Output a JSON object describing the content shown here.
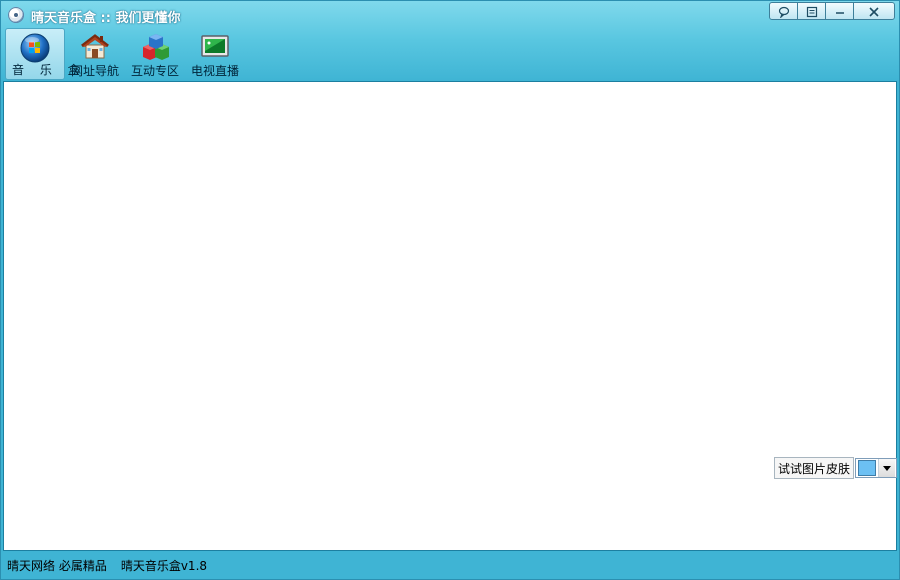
{
  "window": {
    "title": "晴天音乐盒 :: 我们更懂你",
    "controls": [
      "chat-icon",
      "menu-icon",
      "minimize-icon",
      "close-icon"
    ]
  },
  "toolbar": {
    "items": [
      {
        "label": "音 乐 盒",
        "icon": "music-box-orb-icon",
        "active": true
      },
      {
        "label": "网址导航",
        "icon": "house-icon",
        "active": false
      },
      {
        "label": "互动专区",
        "icon": "blocks-icon",
        "active": false
      },
      {
        "label": "电视直播",
        "icon": "tv-screen-icon",
        "active": false
      }
    ]
  },
  "skin": {
    "label": "试试图片皮肤",
    "selected_color": "#6cc0f3"
  },
  "status": {
    "left": "晴天网络 必属精品",
    "version": "晴天音乐盒v1.8"
  },
  "colors": {
    "accent": "#3fb4d4",
    "title_text": "#ffffff"
  }
}
